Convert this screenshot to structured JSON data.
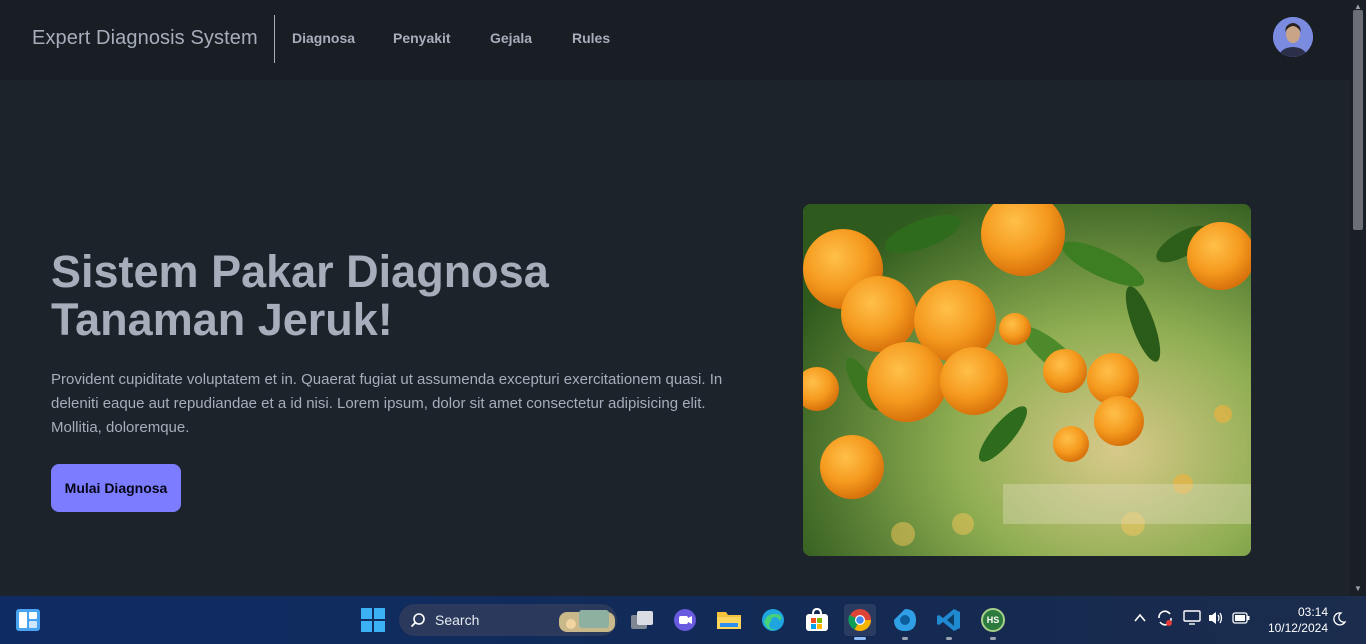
{
  "navbar": {
    "brand": "Expert Diagnosis System",
    "items": [
      {
        "label": "Diagnosa"
      },
      {
        "label": "Penyakit"
      },
      {
        "label": "Gejala"
      },
      {
        "label": "Rules"
      }
    ]
  },
  "hero": {
    "title_line1": "Sistem Pakar Diagnosa",
    "title_line2": "Tanaman Jeruk!",
    "description": "Provident cupiditate voluptatem et in. Quaerat fugiat ut assumenda excepturi exercitationem quasi. In deleniti eaque aut repudiandae et a id nisi. Lorem ipsum, dolor sit amet consectetur adipisicing elit. Mollitia, doloremque.",
    "cta_label": "Mulai Diagnosa"
  },
  "taskbar": {
    "search_label": "Search",
    "time": "03:14",
    "date": "10/12/2024",
    "apps": [
      "start-icon",
      "search-icon",
      "task-view-icon",
      "chat-icon",
      "file-explorer-icon",
      "edge-icon",
      "store-icon",
      "chrome-icon",
      "app-icon",
      "vscode-icon",
      "hs-icon"
    ],
    "hs_label": "HS"
  },
  "colors": {
    "page_bg": "#1d232a",
    "navbar_bg": "#191e24",
    "text": "#a6adbb",
    "primary": "#7b7cff"
  }
}
